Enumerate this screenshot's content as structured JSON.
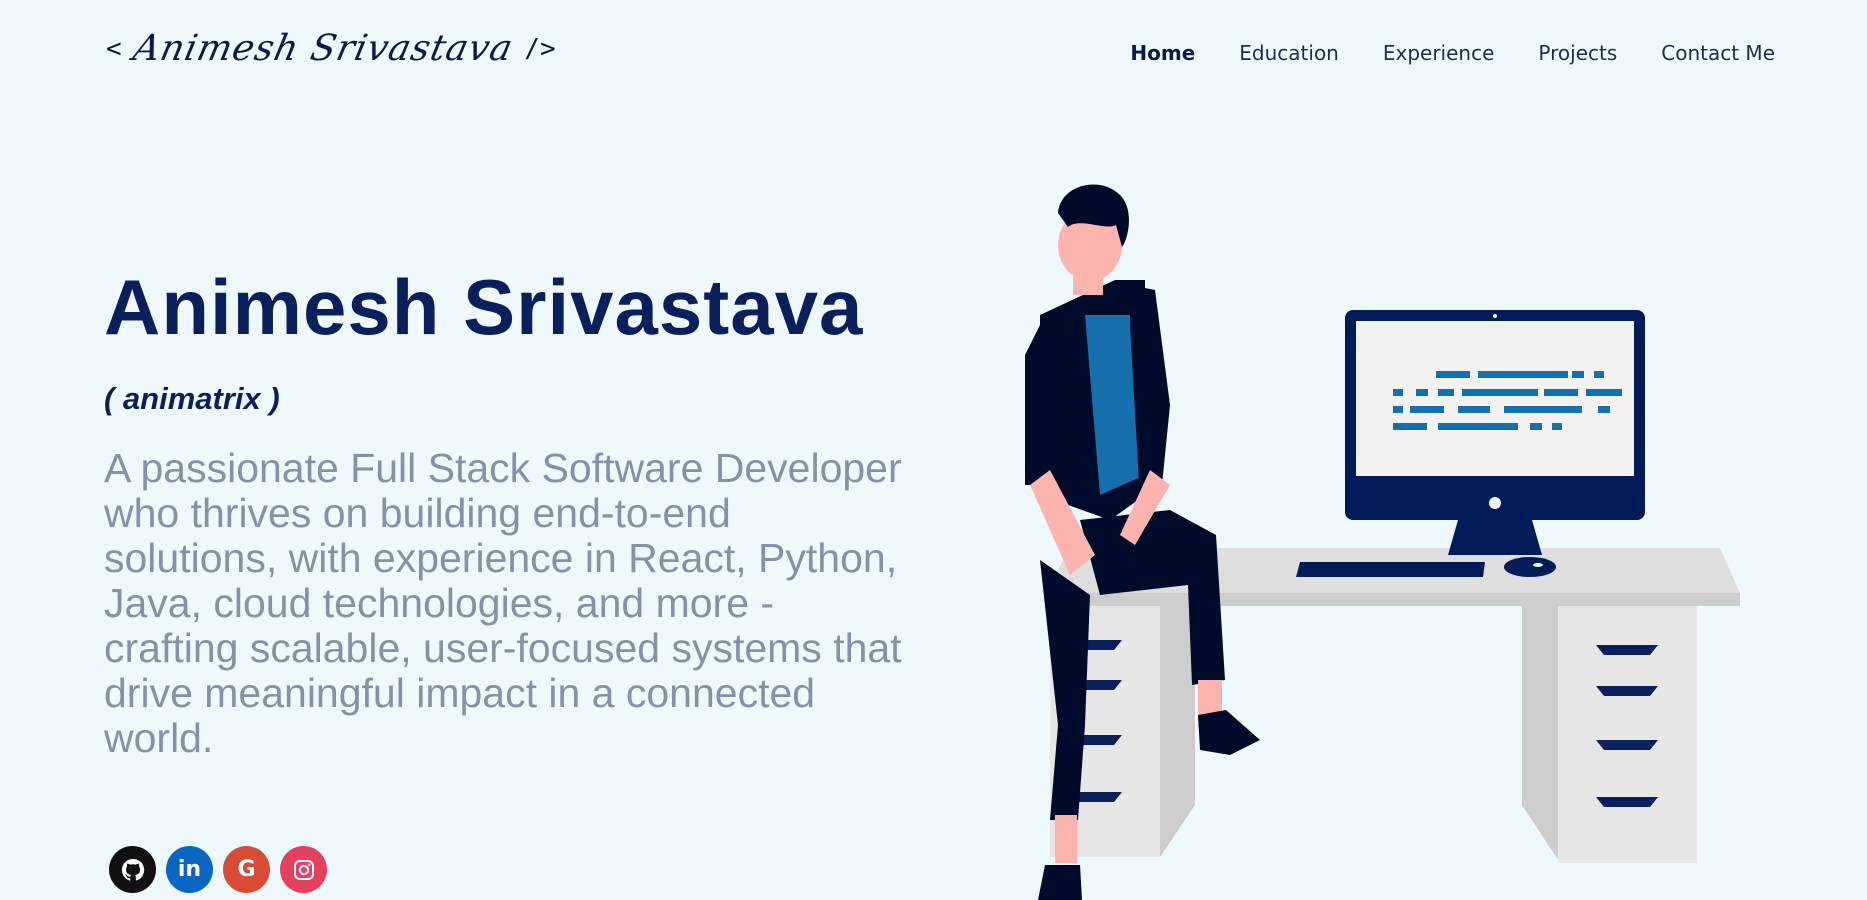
{
  "header": {
    "logo": {
      "open": "<",
      "signature": "Animesh Srivastava",
      "close": "/>"
    },
    "nav": [
      {
        "label": "Home",
        "active": true
      },
      {
        "label": "Education"
      },
      {
        "label": "Experience"
      },
      {
        "label": "Projects"
      },
      {
        "label": "Contact Me"
      }
    ]
  },
  "hero": {
    "name": "Animesh Srivastava",
    "handle": "( animatrix )",
    "bio": "A passionate Full Stack Software Developer who thrives on building end-to-end solutions, with experience in React, Python, Java, cloud technologies, and more - crafting scalable, user-focused systems that drive meaningful impact in a connected world."
  },
  "socials": [
    {
      "name": "github",
      "glyph": "⌥"
    },
    {
      "name": "linkedin",
      "glyph": "in"
    },
    {
      "name": "google",
      "glyph": "G"
    },
    {
      "name": "instagram",
      "glyph": "◎"
    }
  ],
  "colors": {
    "background": "#EEF9FE",
    "heading": "#0B1F5C",
    "bio_text": "#8591AA",
    "accent_blue": "#1570AD",
    "navy": "#001B58"
  }
}
